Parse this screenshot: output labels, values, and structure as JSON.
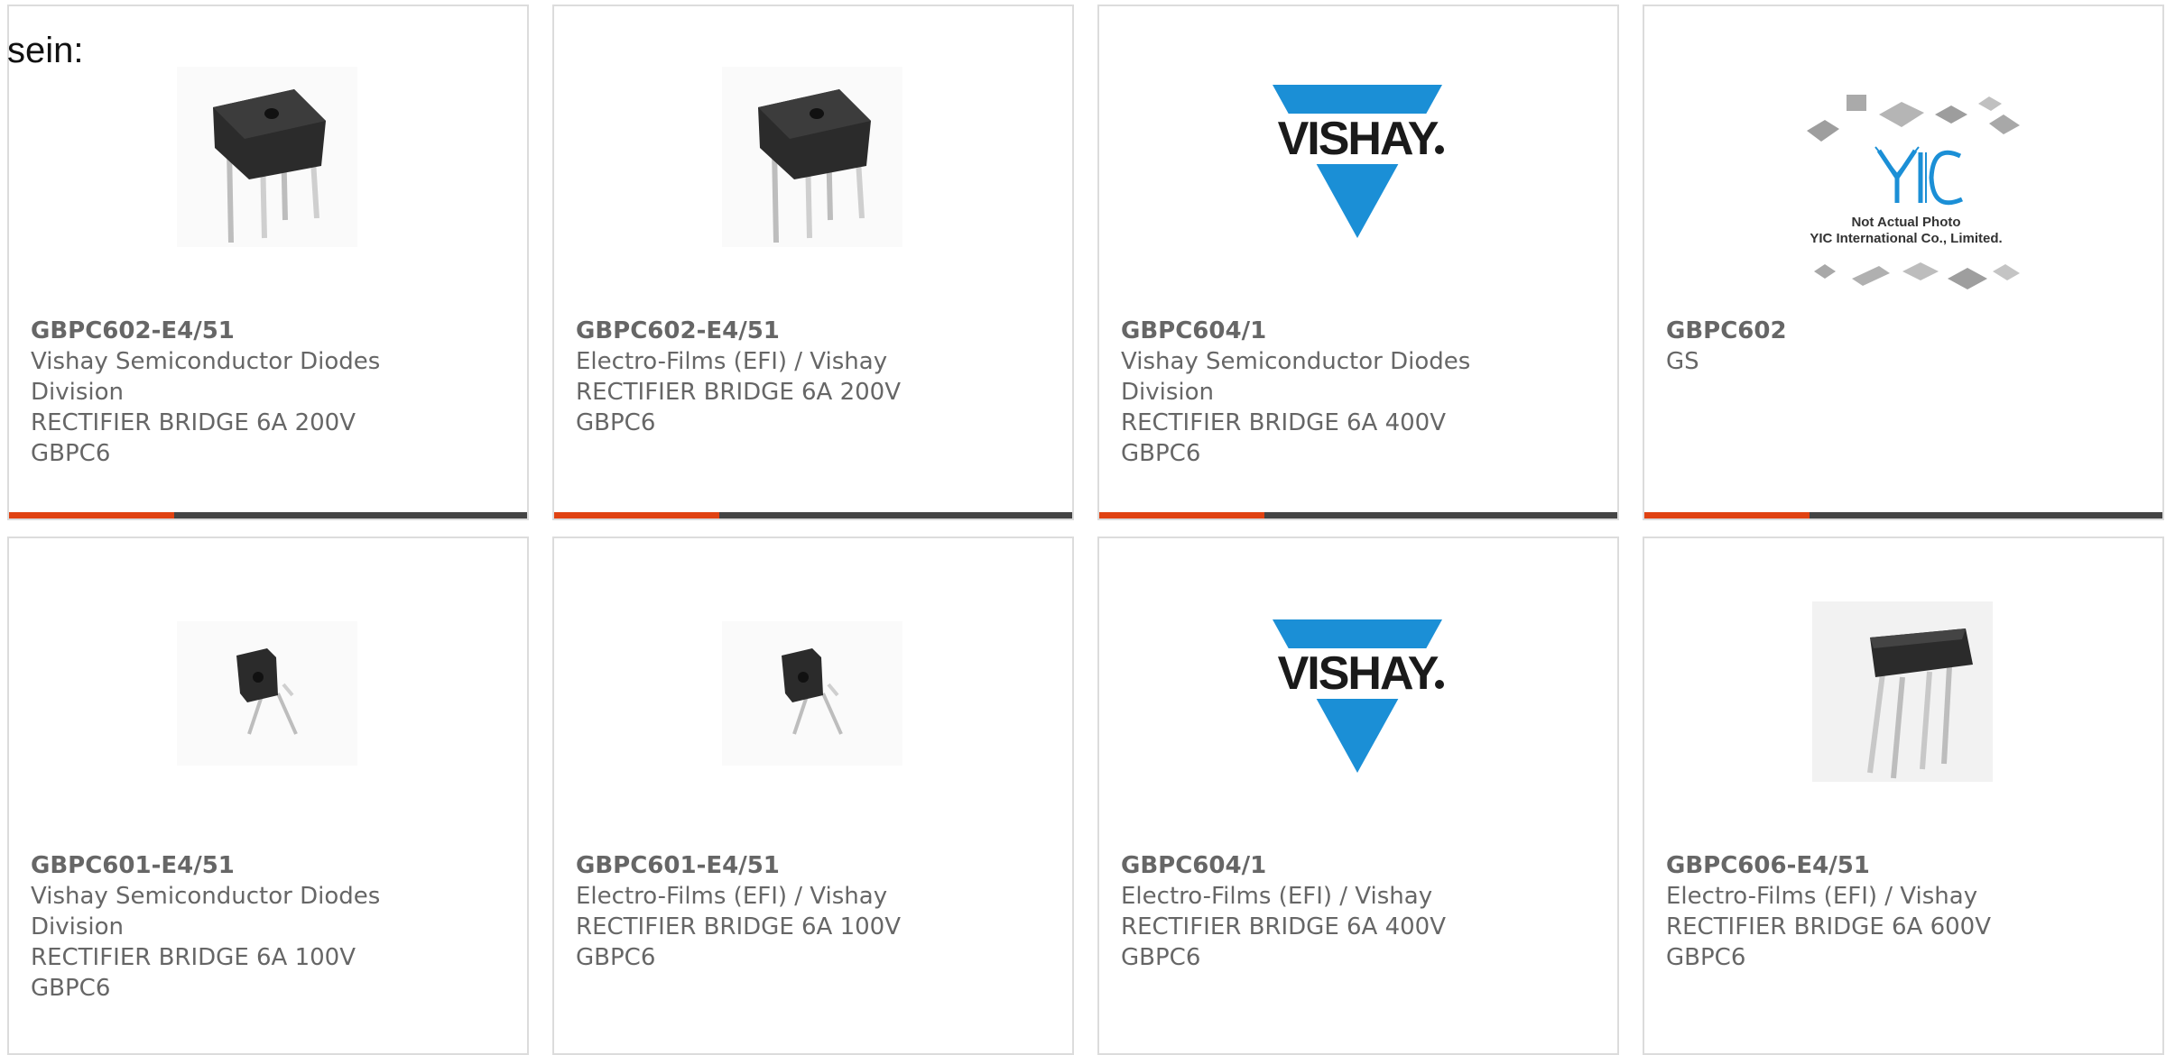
{
  "intro_text": "sein:",
  "colors": {
    "accent": "#e04212",
    "bar": "#444444",
    "border": "#dcdcdc",
    "text": "#666666"
  },
  "products": [
    {
      "part": "GBPC602-E4/51",
      "lines": [
        "Vishay Semiconductor Diodes",
        "Division",
        "RECTIFIER BRIDGE 6A 200V",
        "GBPC6"
      ],
      "image": "bridge-rectifier-square"
    },
    {
      "part": "GBPC602-E4/51",
      "lines": [
        "Electro-Films (EFI) / Vishay",
        "RECTIFIER BRIDGE 6A 200V",
        "GBPC6"
      ],
      "image": "bridge-rectifier-square"
    },
    {
      "part": "GBPC604/1",
      "lines": [
        "Vishay Semiconductor Diodes",
        "Division",
        "RECTIFIER BRIDGE 6A 400V",
        "GBPC6"
      ],
      "image": "vishay-logo"
    },
    {
      "part": "GBPC602",
      "lines": [
        "GS"
      ],
      "image": "not-actual-photo",
      "placeholder_texts": [
        "Not Actual Photo",
        "YIC International Co., Limited."
      ]
    },
    {
      "part": "GBPC601-E4/51",
      "lines": [
        "Vishay Semiconductor Diodes",
        "Division",
        "RECTIFIER BRIDGE 6A 100V",
        "GBPC6"
      ],
      "image": "bridge-rectifier-small"
    },
    {
      "part": "GBPC601-E4/51",
      "lines": [
        "Electro-Films (EFI) / Vishay",
        "RECTIFIER BRIDGE 6A 100V",
        "GBPC6"
      ],
      "image": "bridge-rectifier-small"
    },
    {
      "part": "GBPC604/1",
      "lines": [
        "Electro-Films (EFI) / Vishay",
        "RECTIFIER BRIDGE 6A 400V",
        "GBPC6"
      ],
      "image": "vishay-logo"
    },
    {
      "part": "GBPC606-E4/51",
      "lines": [
        "Electro-Films (EFI) / Vishay",
        "RECTIFIER BRIDGE 6A 600V",
        "GBPC6"
      ],
      "image": "bridge-rectifier-long-leads"
    }
  ]
}
